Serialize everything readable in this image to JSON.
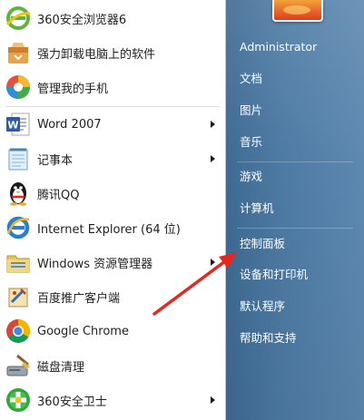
{
  "programs": [
    {
      "label": "360安全浏览器6",
      "icon": "360-browser-icon",
      "submenu": false
    },
    {
      "label": "强力卸载电脑上的软件",
      "icon": "uninstall-box-icon",
      "submenu": false
    },
    {
      "label": "管理我的手机",
      "icon": "phone-manager-icon",
      "submenu": false
    },
    {
      "label": "Word 2007",
      "icon": "word-icon",
      "submenu": true
    },
    {
      "label": "记事本",
      "icon": "notepad-icon",
      "submenu": true
    },
    {
      "label": "腾讯QQ",
      "icon": "qq-penguin-icon",
      "submenu": false
    },
    {
      "label": "Internet Explorer (64 位)",
      "icon": "internet-explorer-icon",
      "submenu": false
    },
    {
      "label": "Windows 资源管理器",
      "icon": "explorer-folder-icon",
      "submenu": true
    },
    {
      "label": "百度推广客户端",
      "icon": "baidu-client-icon",
      "submenu": false
    },
    {
      "label": "Google Chrome",
      "icon": "chrome-icon",
      "submenu": false
    },
    {
      "label": "磁盘清理",
      "icon": "disk-cleanup-icon",
      "submenu": false
    },
    {
      "label": "360安全卫士",
      "icon": "360-security-icon",
      "submenu": true
    }
  ],
  "right_panel": {
    "user": "Administrator",
    "items": [
      "文档",
      "图片",
      "音乐",
      "游戏",
      "计算机",
      "控制面板",
      "设备和打印机",
      "默认程序",
      "帮助和支持"
    ]
  },
  "colors": {
    "right_panel": "#4d7aa3",
    "annotation_arrow": "#e8261f"
  }
}
